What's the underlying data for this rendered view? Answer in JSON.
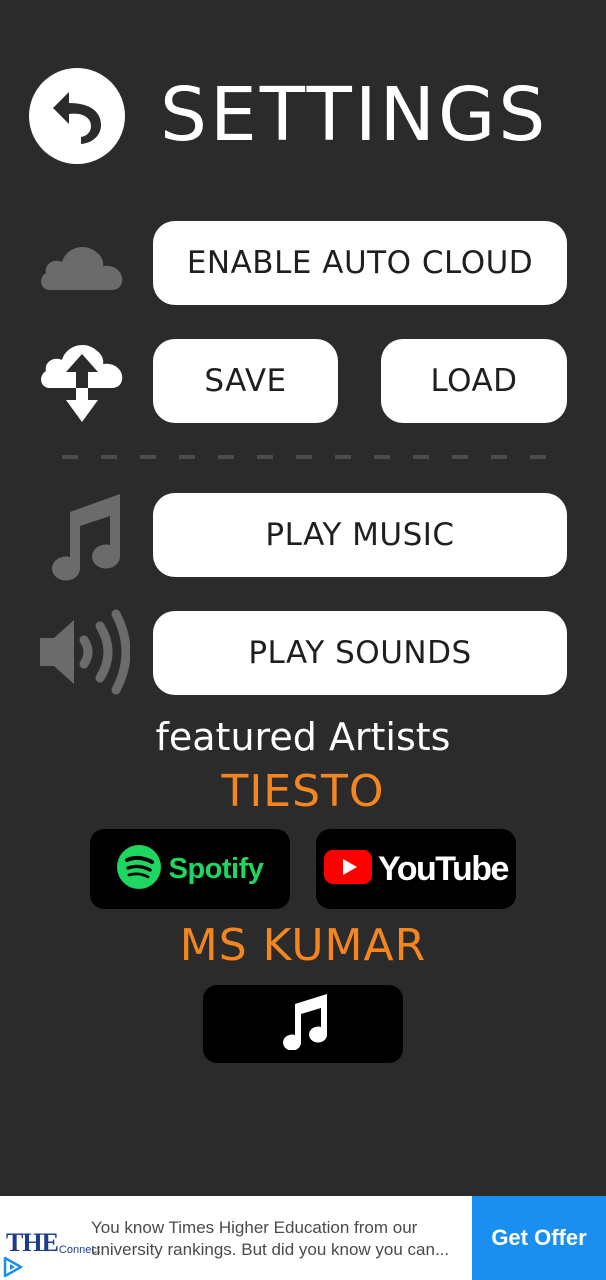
{
  "header": {
    "title": "SETTINGS",
    "back_icon": "back-arrow-icon"
  },
  "cloud": {
    "auto_cloud_label": "ENABLE AUTO CLOUD",
    "save_label": "SAVE",
    "load_label": "LOAD",
    "cloud_icon": "cloud-icon",
    "sync_icon": "cloud-upload-download-icon"
  },
  "audio": {
    "music_label": "PLAY MUSIC",
    "sounds_label": "PLAY SOUNDS",
    "music_icon": "music-note-icon",
    "sound_icon": "speaker-icon"
  },
  "featured": {
    "heading": "featured Artists",
    "artists": [
      {
        "name": "TIESTO",
        "links": [
          {
            "label": "Spotify",
            "icon": "spotify-icon"
          },
          {
            "label": "YouTube",
            "icon": "youtube-icon"
          }
        ]
      },
      {
        "name": "MS KUMAR",
        "links": [
          {
            "label": "",
            "icon": "music-note-icon"
          }
        ]
      }
    ]
  },
  "ad": {
    "logo_main": "THE",
    "logo_sub": "Connect",
    "text": "You know Times Higher Education from our university rankings. But did you know you can...",
    "cta": "Get Offer"
  },
  "colors": {
    "background": "#2b2b2b",
    "button": "#ffffff",
    "disabled_icon": "#6b6b6b",
    "artist_accent": "#f5851f",
    "spotify_green": "#1ed760",
    "youtube_red": "#ff0000",
    "ad_cta": "#1a8ff0"
  }
}
